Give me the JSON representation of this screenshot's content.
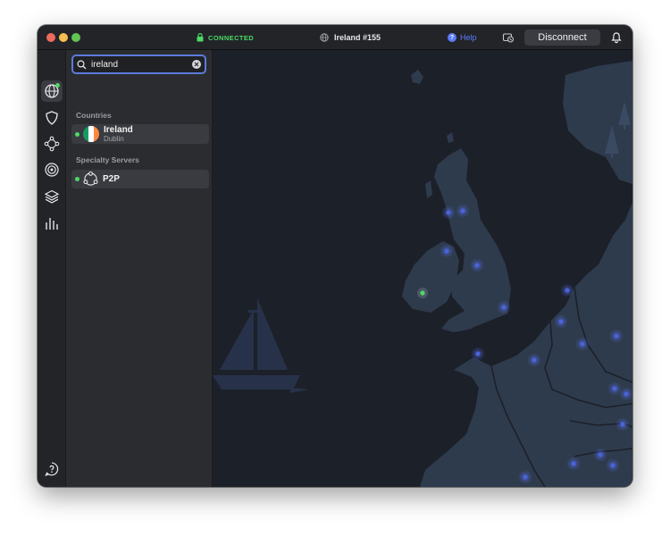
{
  "titlebar": {
    "status": "CONNECTED",
    "server": "Ireland #155",
    "help": "Help",
    "disconnect": "Disconnect"
  },
  "sidebar_rail": {
    "items": [
      "globe-icon",
      "shield-icon",
      "meshnet-icon",
      "target-icon",
      "layers-icon",
      "stats-icon"
    ],
    "bottom_items": [
      "support-icon",
      "settings-icon"
    ]
  },
  "search": {
    "value": "ireland"
  },
  "sections": {
    "countries": "Countries",
    "specialty": "Specialty Servers"
  },
  "results": {
    "country": {
      "name": "Ireland",
      "city": "Dublin"
    },
    "specialty": {
      "name": "P2P"
    }
  },
  "map": {
    "zoom_out": "−",
    "zoom_in": "+"
  },
  "colors": {
    "accent_blue": "#5c7bff",
    "connected_green": "#4cd964",
    "map_sea": "#1c2029",
    "map_land": "#2e3b4d",
    "server_pin": "#4a63d9"
  }
}
